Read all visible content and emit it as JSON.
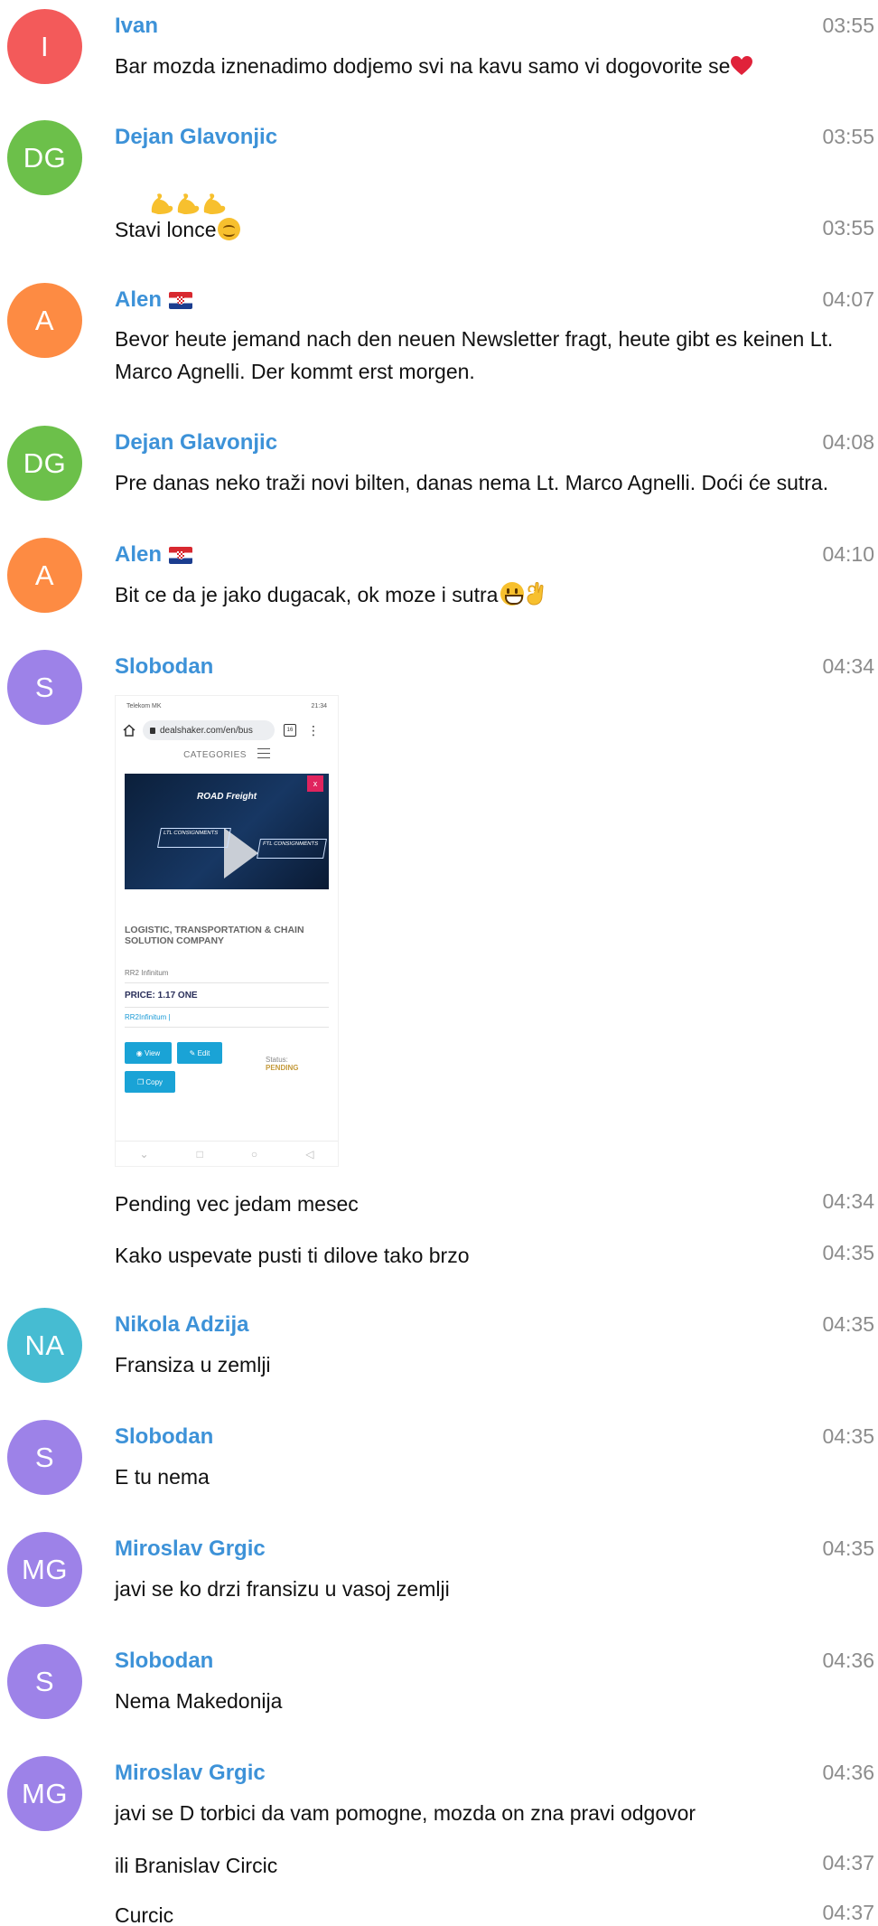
{
  "colors": {
    "sender_name": "#3d92d8",
    "timestamp": "#8c8c8c",
    "message_text": "#111111"
  },
  "messages": [
    {
      "avatar_initials": "I",
      "avatar_color": "#f35a5a",
      "sender": "Ivan",
      "time": "03:55",
      "text": "Bar mozda iznenadimo dodjemo svi na kavu samo vi dogovorite se",
      "emoji": "red-heart"
    },
    {
      "avatar_initials": "DG",
      "avatar_color": "#6cc04a",
      "sender": "Dejan Glavonjic",
      "time": "03:55",
      "emoji_line": "flexed-biceps x3",
      "followup_text": "Stavi lonce",
      "followup_time": "03:55",
      "emoji": "smiling-face"
    },
    {
      "avatar_initials": "A",
      "avatar_color": "#fd8b43",
      "sender": "Alen",
      "flag": "croatia-flag",
      "time": "04:07",
      "text": "Bevor heute jemand nach den neuen Newsletter fragt, heute gibt es keinen Lt. Marco Agnelli. Der kommt erst morgen."
    },
    {
      "avatar_initials": "DG",
      "avatar_color": "#6cc04a",
      "sender": "Dejan Glavonjic",
      "time": "04:08",
      "text": "Pre danas neko traži novi bilten, danas nema Lt. Marco Agnelli. Doći će sutra."
    },
    {
      "avatar_initials": "A",
      "avatar_color": "#fd8b43",
      "sender": "Alen",
      "flag": "croatia-flag",
      "time": "04:10",
      "text": "Bit ce da je jako dugacak, ok moze i sutra",
      "emoji": "grinning-face ok-hand"
    },
    {
      "avatar_initials": "S",
      "avatar_color": "#9d82e8",
      "sender": "Slobodan",
      "time": "04:34"
    },
    {
      "text": "Pending vec jedam mesec",
      "time": "04:34"
    },
    {
      "text": "Kako uspevate pusti ti dilove tako brzo",
      "time": "04:35"
    },
    {
      "avatar_initials": "NA",
      "avatar_color": "#46bcd2",
      "sender": "Nikola Adzija",
      "time": "04:35",
      "text": "Fransiza u zemlji"
    },
    {
      "avatar_initials": "S",
      "avatar_color": "#9d82e8",
      "sender": "Slobodan",
      "time": "04:35",
      "text": "E tu nema"
    },
    {
      "avatar_initials": "MG",
      "avatar_color": "#9d82e8",
      "sender": "Miroslav Grgic",
      "time": "04:35",
      "text": "javi se ko drzi fransizu u vasoj zemlji"
    },
    {
      "avatar_initials": "S",
      "avatar_color": "#9d82e8",
      "sender": "Slobodan",
      "time": "04:36",
      "text": "Nema Makedonija"
    },
    {
      "avatar_initials": "MG",
      "avatar_color": "#9d82e8",
      "sender": "Miroslav Grgic",
      "time": "04:36",
      "text": "javi se D torbici da vam pomogne, mozda on zna pravi odgovor"
    },
    {
      "text": "ili Branislav Circic",
      "time": "04:37"
    },
    {
      "text": "Curcic",
      "time": "04:37"
    }
  ],
  "screenshot": {
    "status_left": "Telekom MK",
    "status_right": "21:34",
    "url": "dealshaker.com/en/bus",
    "tab_count": "16",
    "nav_label": "CATEGORIES",
    "banner_title": "ROAD Freight",
    "banner_box1": "LTL CONSIGNMENTS",
    "banner_box2": "FTL CONSIGNMENTS",
    "close_label": "x",
    "heading": "LOGISTIC, TRANSPORTATION & CHAIN SOLUTION COMPANY",
    "seller": "RR2 Infinitum",
    "price": "PRICE: 1.17 ONE",
    "link": "RR2Infinitum  |",
    "view_label": "View",
    "edit_label": "Edit",
    "copy_label": "Copy",
    "status_label": "Status:",
    "status_value": "PENDING"
  }
}
